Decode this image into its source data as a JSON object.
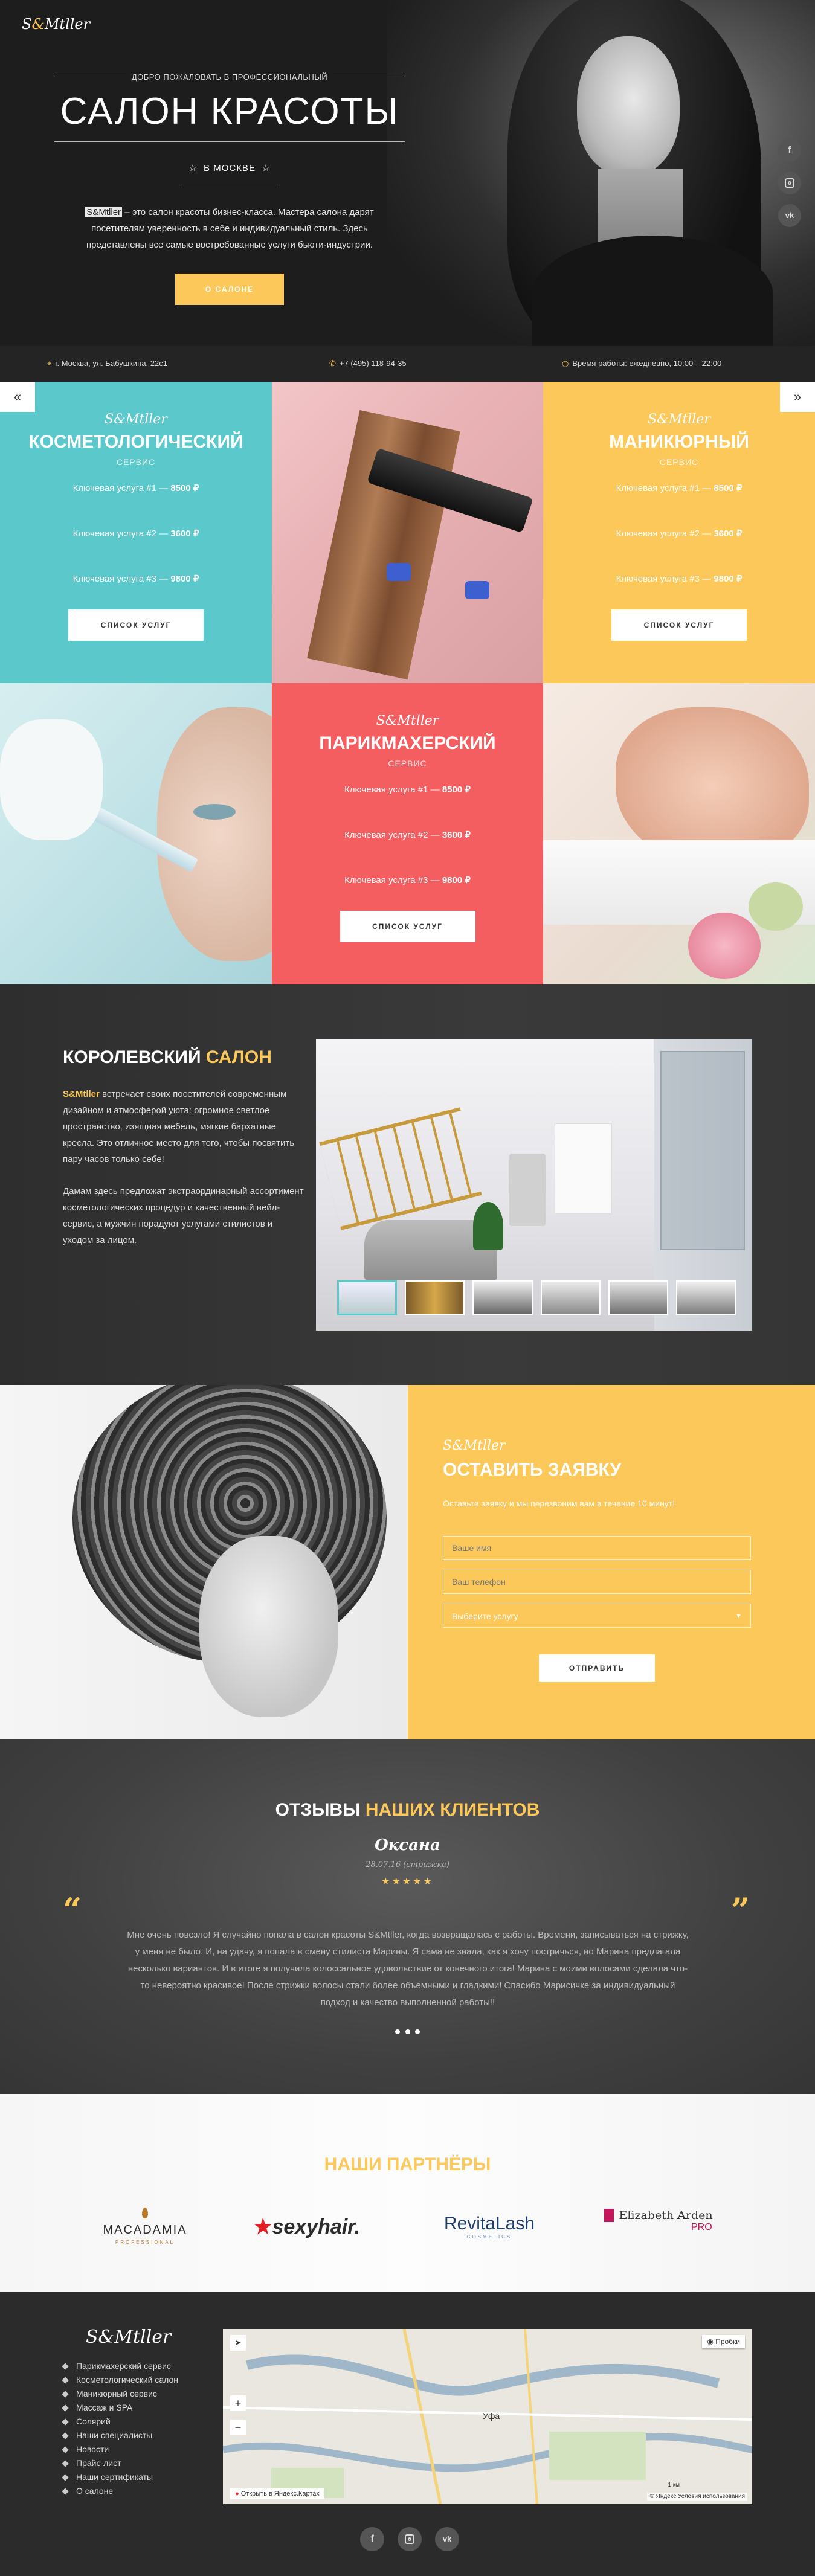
{
  "brand": {
    "logo_pre": "S",
    "logo_amp": "&",
    "logo_post": "Mtller"
  },
  "colors": {
    "teal": "#5bc9cc",
    "coral": "#f45e61",
    "yellow": "#fbc859",
    "dark": "#2b2b2b"
  },
  "hero": {
    "welcome": "ДОБРО ПОЖАЛОВАТЬ В ПРОФЕССИОНАЛЬНЫЙ",
    "title": "САЛОН КРАСОТЫ",
    "city": "В МОСКВЕ",
    "desc_brand": "S&Mtller",
    "desc": "– это салон красоты бизнес-класса. Мастера салона дарят посетителям уверенность в себе и индивидуальный стиль. Здесь представлены все самые востребованные услуги бьюти-индустрии.",
    "cta": "О САЛОНЕ"
  },
  "social": [
    "facebook-icon",
    "instagram-icon",
    "vk-icon"
  ],
  "infobar": {
    "address": "г. Москва, ул. Бабушкина, 22с1",
    "phone": "+7 (495) 118-94-35",
    "hours": "Время работы: ежедневно, 10:00 – 22:00"
  },
  "services": {
    "cosmetology": {
      "logo": "S&Mtller",
      "title": "КОСМЕТОЛОГИЧЕСКИЙ",
      "subtitle": "СЕРВИС",
      "items": [
        {
          "name": "Ключевая услуга #1",
          "price": "8500 ₽"
        },
        {
          "name": "Ключевая услуга #2",
          "price": "3600 ₽"
        },
        {
          "name": "Ключевая услуга #3",
          "price": "9800 ₽"
        }
      ],
      "button": "СПИСОК УСЛУГ"
    },
    "manicure": {
      "logo": "S&Mtller",
      "title": "МАНИКЮРНЫЙ",
      "subtitle": "СЕРВИС",
      "items": [
        {
          "name": "Ключевая услуга #1",
          "price": "8500 ₽"
        },
        {
          "name": "Ключевая услуга #2",
          "price": "3600 ₽"
        },
        {
          "name": "Ключевая услуга #3",
          "price": "9800 ₽"
        }
      ],
      "button": "СПИСОК УСЛУГ"
    },
    "hair": {
      "logo": "S&Mtller",
      "title": "ПАРИКМАХЕРСКИЙ",
      "subtitle": "СЕРВИС",
      "items": [
        {
          "name": "Ключевая услуга #1",
          "price": "8500 ₽"
        },
        {
          "name": "Ключевая услуга #2",
          "price": "3600 ₽"
        },
        {
          "name": "Ключевая услуга #3",
          "price": "9800 ₽"
        }
      ],
      "button": "СПИСОК УСЛУГ"
    }
  },
  "royal": {
    "title_a": "КОРОЛЕВСКИЙ",
    "title_b": "САЛОН",
    "p1_brand": "S&Mtller",
    "p1": "встречает своих посетителей современным дизайном и атмосферой уюта: огромное светлое пространство, изящная мебель, мягкие бархатные кресла. Это отличное место для того, чтобы посвятить пару часов только себе!",
    "p2": "Дамам здесь предложат экстраординарный ассортимент косметологических процедур и качественный нейл-сервис, а мужчин порадуют услугами стилистов и уходом за лицом."
  },
  "form": {
    "logo": "S&Mtller",
    "title": "ОСТАВИТЬ ЗАЯВКУ",
    "desc": "Оставьте заявку и мы перезвоним вам в течение 10 минут!",
    "name_ph": "Ваше имя",
    "phone_ph": "Ваш телефон",
    "select": "Выберите услугу",
    "submit": "ОТПРАВИТЬ"
  },
  "reviews": {
    "title_a": "ОТЗЫВЫ",
    "title_b": "НАШИХ КЛИЕНТОВ",
    "name": "Оксана",
    "date": "28.07.16 (стрижка)",
    "rating": 5,
    "text": "Мне очень повезло! Я случайно попала в салон красоты S&Mtller, когда возвращалась с работы. Времени, записываться на стрижку, у меня не было. И, на удачу, я попала в смену стилиста Марины. Я сама не знала, как я хочу постричься, но Марина предлагала несколько вариантов. И в итоге я получила колоссальное удовольствие от конечного итога! Марина с моими волосами сделала что-то невероятно красивое! После стрижки волосы стали более объемными и гладкими! Спасибо Марисичке за индивидуальный подход и качество выполненной работы!!"
  },
  "partners": {
    "title": "НАШИ ПАРТНЁРЫ",
    "items": [
      {
        "name": "MACADAMIA",
        "sub": "PROFESSIONAL"
      },
      {
        "name": "sexyhair.",
        "sub": ""
      },
      {
        "name": "RevitaLash",
        "sub": "COSMETICS"
      },
      {
        "name": "Elizabeth Arden",
        "sub": "PRO"
      }
    ]
  },
  "footer": {
    "logo": "S&Mtller",
    "links": [
      "Парикмахерский сервис",
      "Косметологический салон",
      "Маникюрный сервис",
      "Массаж и SPA",
      "Солярий",
      "Наши специалисты",
      "Новости",
      "Прайс-лист",
      "Наши сертификаты",
      "О салоне"
    ],
    "map": {
      "city": "Уфа",
      "traffic": "Пробки",
      "open": "Открыть в Яндекс.Картах",
      "terms": "© Яндекс Условия использования",
      "scale": "1 км"
    }
  }
}
